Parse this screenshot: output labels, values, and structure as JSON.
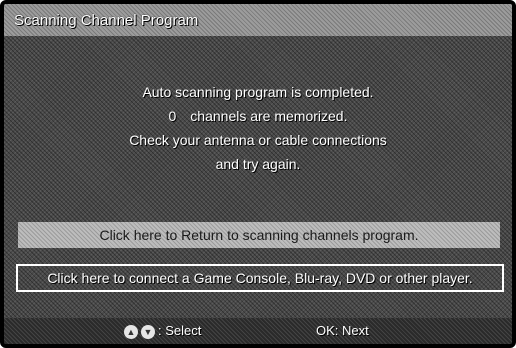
{
  "window": {
    "title": "Scanning Channel Program"
  },
  "message": {
    "line1": "Auto scanning program is completed.",
    "count": "0",
    "line2": "channels are memorized.",
    "line3": "Check your antenna or cable connections",
    "line4": "and try again."
  },
  "buttons": {
    "return_label": "Click here to Return to scanning channels program.",
    "connect_label": "Click here to connect a Game Console, Blu-ray, DVD or other player."
  },
  "footer": {
    "up_icon_glyph": "▲",
    "down_icon_glyph": "▼",
    "select_label": ": Select",
    "next_label": "OK: Next"
  }
}
